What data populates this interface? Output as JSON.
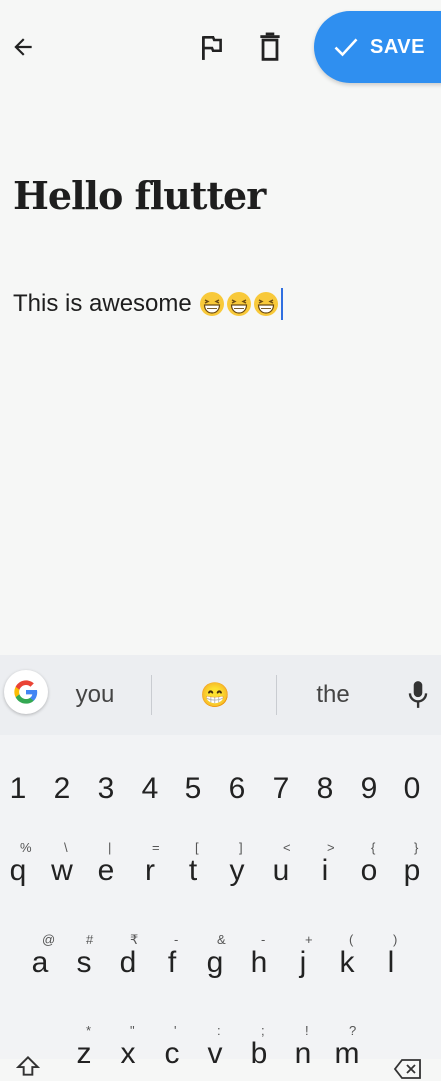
{
  "toolbar": {
    "back_icon": "arrow-back-icon",
    "flag_icon": "flag-icon",
    "delete_icon": "trash-icon",
    "save_label": "SAVE",
    "save_icon": "checkmark-icon",
    "accent_color": "#2f8ff0"
  },
  "note": {
    "title": "Hello flutter",
    "body": "This is awesome",
    "body_emoji_count": 3,
    "emoji": "grinning-squinting-face"
  },
  "keyboard": {
    "suggestions": [
      "you",
      "😁",
      "the"
    ],
    "number_row": [
      "1",
      "2",
      "3",
      "4",
      "5",
      "6",
      "7",
      "8",
      "9",
      "0"
    ],
    "row1": [
      {
        "key": "q",
        "hint": "%"
      },
      {
        "key": "w",
        "hint": "\\"
      },
      {
        "key": "e",
        "hint": "|"
      },
      {
        "key": "r",
        "hint": "="
      },
      {
        "key": "t",
        "hint": "["
      },
      {
        "key": "y",
        "hint": "]"
      },
      {
        "key": "u",
        "hint": "<"
      },
      {
        "key": "i",
        "hint": ">"
      },
      {
        "key": "o",
        "hint": "{"
      },
      {
        "key": "p",
        "hint": "}"
      }
    ],
    "row2": [
      {
        "key": "a",
        "hint": "@"
      },
      {
        "key": "s",
        "hint": "#"
      },
      {
        "key": "d",
        "hint": "₹"
      },
      {
        "key": "f",
        "hint": "-"
      },
      {
        "key": "g",
        "hint": "&"
      },
      {
        "key": "h",
        "hint": "-"
      },
      {
        "key": "j",
        "hint": "+"
      },
      {
        "key": "k",
        "hint": "("
      },
      {
        "key": "l",
        "hint": ")"
      }
    ],
    "row3_partial": [
      {
        "key": "z",
        "hint": "*"
      },
      {
        "key": "x",
        "hint": "\""
      },
      {
        "key": "c",
        "hint": "'"
      },
      {
        "key": "v",
        "hint": ":"
      },
      {
        "key": "b",
        "hint": ";"
      },
      {
        "key": "n",
        "hint": "!"
      },
      {
        "key": "m",
        "hint": "?"
      }
    ]
  }
}
